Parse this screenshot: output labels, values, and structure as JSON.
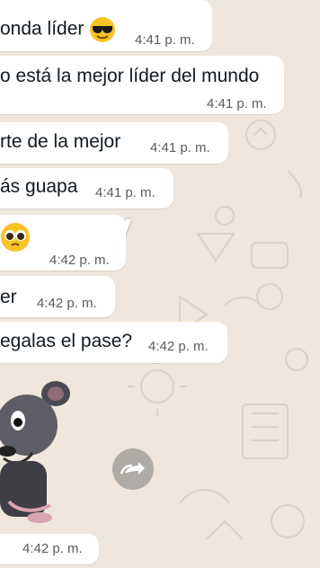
{
  "messages": [
    {
      "text": "onda líder",
      "emoji": "sunglasses-face",
      "time": "4:41 p. m."
    },
    {
      "text": "o está la mejor líder del mundo",
      "time": "4:41 p. m."
    },
    {
      "text": "rte de la mejor",
      "time": "4:41 p. m."
    },
    {
      "text": "ás guapa",
      "time": "4:41 p. m."
    },
    {
      "text": "",
      "emoji": "pleading-face",
      "time": "4:42 p. m."
    },
    {
      "text": "er",
      "time": "4:42 p. m."
    },
    {
      "text": "egalas el pase?",
      "time": "4:42 p. m."
    },
    {
      "text": "",
      "sticker": "rat-sticker",
      "time": "4:42 p. m."
    }
  ],
  "overlay": {
    "text": "y"
  },
  "forward_button": {
    "icon": "forward-icon"
  },
  "colors": {
    "wallpaper": "#efe7dd",
    "bubble": "#ffffff",
    "time": "#5b5b5b",
    "text": "#111b21"
  }
}
